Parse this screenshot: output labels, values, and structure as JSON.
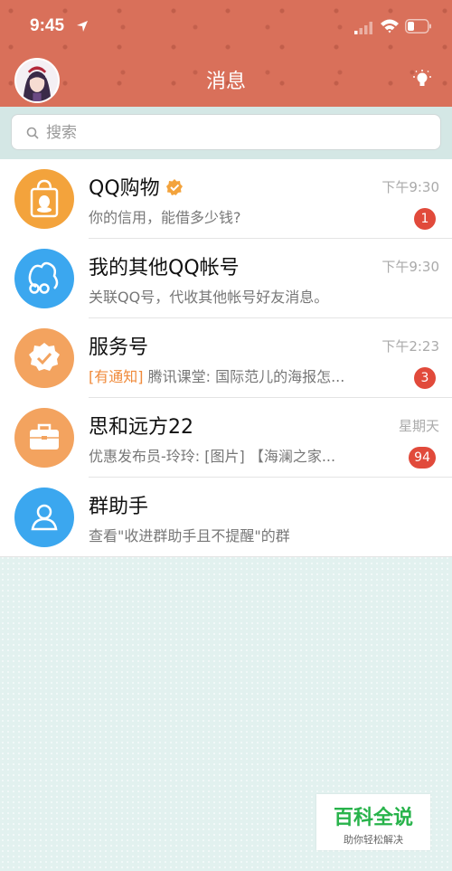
{
  "status_bar": {
    "time": "9:45"
  },
  "header": {
    "title": "消息"
  },
  "search": {
    "placeholder": "搜索"
  },
  "conversations": [
    {
      "title": "QQ购物",
      "subtitle": "你的信用，能借多少钱?",
      "time": "下午9:30",
      "badge": "1",
      "icon": "qq-shopping-bag-icon",
      "color": "#f3a33c",
      "verified": true
    },
    {
      "title": "我的其他QQ帐号",
      "subtitle": "关联QQ号，代收其他帐号好友消息。",
      "time": "下午9:30",
      "icon": "linked-accounts-icon",
      "color": "#3ba7ef"
    },
    {
      "title": "服务号",
      "notice": "[有通知]",
      "subtitle": " 腾讯课堂: 国际范儿的海报怎...",
      "time": "下午2:23",
      "badge": "3",
      "icon": "service-badge-icon",
      "color": "#f3a35f"
    },
    {
      "title": "思和远方22",
      "subtitle": "优惠发布员-玲玲: [图片] 【海澜之家...",
      "time": "星期天",
      "badge": "94",
      "icon": "briefcase-icon",
      "color": "#f3a35f"
    },
    {
      "title": "群助手",
      "subtitle": "查看\"收进群助手且不提醒\"的群",
      "icon": "group-assistant-icon",
      "color": "#3ba7ef"
    }
  ],
  "watermark": {
    "main": "百科全说",
    "sub": "助你轻松解决"
  }
}
